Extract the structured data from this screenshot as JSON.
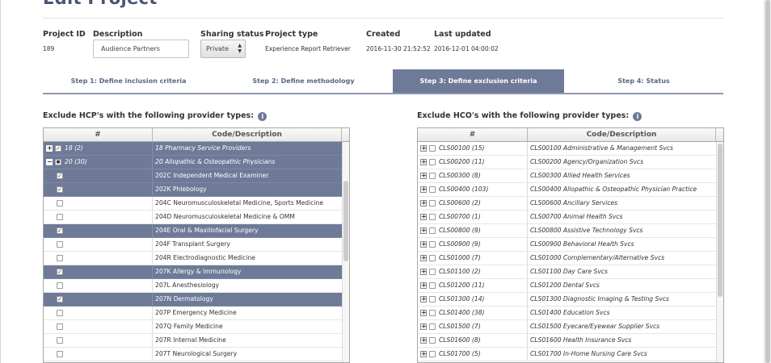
{
  "page": {
    "title": "Edit Project"
  },
  "meta": {
    "project_id_label": "Project ID",
    "project_id": "189",
    "description_label": "Description",
    "description_value": "Audience Partners",
    "sharing_label": "Sharing status",
    "sharing_value": "Private",
    "type_label": "Project type",
    "type_value": "Experience Report Retriever",
    "created_label": "Created",
    "created_value": "2016-11-30 21:52:52",
    "updated_label": "Last updated",
    "updated_value": "2016-12-01 04:00:02"
  },
  "steps": [
    {
      "label": "Step 1: Define inclusion criteria",
      "active": false
    },
    {
      "label": "Step 2: Define methodology",
      "active": false
    },
    {
      "label": "Step 3: Define exclusion criteria",
      "active": true
    },
    {
      "label": "Step 4: Status",
      "active": false
    }
  ],
  "hcp": {
    "title": "Exclude HCP's with the following provider types:",
    "col1": "#",
    "col2": "Code/Description",
    "rows": [
      {
        "kind": "group",
        "toggle": "+",
        "checked": true,
        "label": "18 (2)",
        "desc": "18 Pharmacy Service Providers",
        "sel": true
      },
      {
        "kind": "group",
        "toggle": "−",
        "checked": "partial",
        "label": "20 (30)",
        "desc": "20 Allopathic & Osteopathic Physicians",
        "sel": true
      },
      {
        "kind": "item",
        "checked": true,
        "desc": "202C Independent Medical Examiner",
        "sel": true
      },
      {
        "kind": "item",
        "checked": true,
        "desc": "202K Phlebology",
        "sel": true
      },
      {
        "kind": "item",
        "checked": false,
        "desc": "204C Neuromusculoskeletal Medicine, Sports Medicine",
        "sel": false
      },
      {
        "kind": "item",
        "checked": false,
        "desc": "204D Neuromusculoskeletal Medicine & OMM",
        "sel": false
      },
      {
        "kind": "item",
        "checked": true,
        "desc": "204E Oral & Maxillofacial Surgery",
        "sel": true
      },
      {
        "kind": "item",
        "checked": false,
        "desc": "204F Transplant Surgery",
        "sel": false
      },
      {
        "kind": "item",
        "checked": false,
        "desc": "204R Electrodiagnostic Medicine",
        "sel": false
      },
      {
        "kind": "item",
        "checked": true,
        "desc": "207K Allergy & Immunology",
        "sel": true
      },
      {
        "kind": "item",
        "checked": false,
        "desc": "207L Anesthesiology",
        "sel": false
      },
      {
        "kind": "item",
        "checked": true,
        "desc": "207N Dermatology",
        "sel": true
      },
      {
        "kind": "item",
        "checked": false,
        "desc": "207P Emergency Medicine",
        "sel": false
      },
      {
        "kind": "item",
        "checked": false,
        "desc": "207Q Family Medicine",
        "sel": false
      },
      {
        "kind": "item",
        "checked": false,
        "desc": "207R Internal Medicine",
        "sel": false
      },
      {
        "kind": "item",
        "checked": false,
        "desc": "207T Neurological Surgery",
        "sel": false
      }
    ]
  },
  "hco": {
    "title": "Exclude HCO's with the following provider types:",
    "col1": "#",
    "col2": "Code/Description",
    "rows": [
      {
        "label": "CLS00100 (15)",
        "desc": "CLS00100 Administrative & Management Svcs"
      },
      {
        "label": "CLS00200 (11)",
        "desc": "CLS00200 Agency/Organization Svcs"
      },
      {
        "label": "CLS00300 (8)",
        "desc": "CLS00300 Allied Health Services"
      },
      {
        "label": "CLS00400 (103)",
        "desc": "CLS00400 Allopathic & Osteopathic Physician Practice"
      },
      {
        "label": "CLS00600 (2)",
        "desc": "CLS00600 Ancillary Services"
      },
      {
        "label": "CLS00700 (1)",
        "desc": "CLS00700 Animal Health Svcs"
      },
      {
        "label": "CLS00800 (9)",
        "desc": "CLS00800 Assistive Technology Svcs"
      },
      {
        "label": "CLS00900 (9)",
        "desc": "CLS00900 Behavioral Health Svcs"
      },
      {
        "label": "CLS01000 (7)",
        "desc": "CLS01000 Complementary/Alternative Svcs"
      },
      {
        "label": "CLS01100 (2)",
        "desc": "CLS01100 Day Care Svcs"
      },
      {
        "label": "CLS01200 (11)",
        "desc": "CLS01200 Dental Svcs"
      },
      {
        "label": "CLS01300 (14)",
        "desc": "CLS01300 Diagnostic Imaging & Testing Svcs"
      },
      {
        "label": "CLS01400 (38)",
        "desc": "CLS01400 Education Svcs"
      },
      {
        "label": "CLS01500 (7)",
        "desc": "CLS01500 Eyecare/Eyewear Supplier Svcs"
      },
      {
        "label": "CLS01600 (8)",
        "desc": "CLS01600 Health Insurance Svcs"
      },
      {
        "label": "CLS01700 (5)",
        "desc": "CLS01700 In-Home Nursing Care Svcs"
      }
    ]
  }
}
